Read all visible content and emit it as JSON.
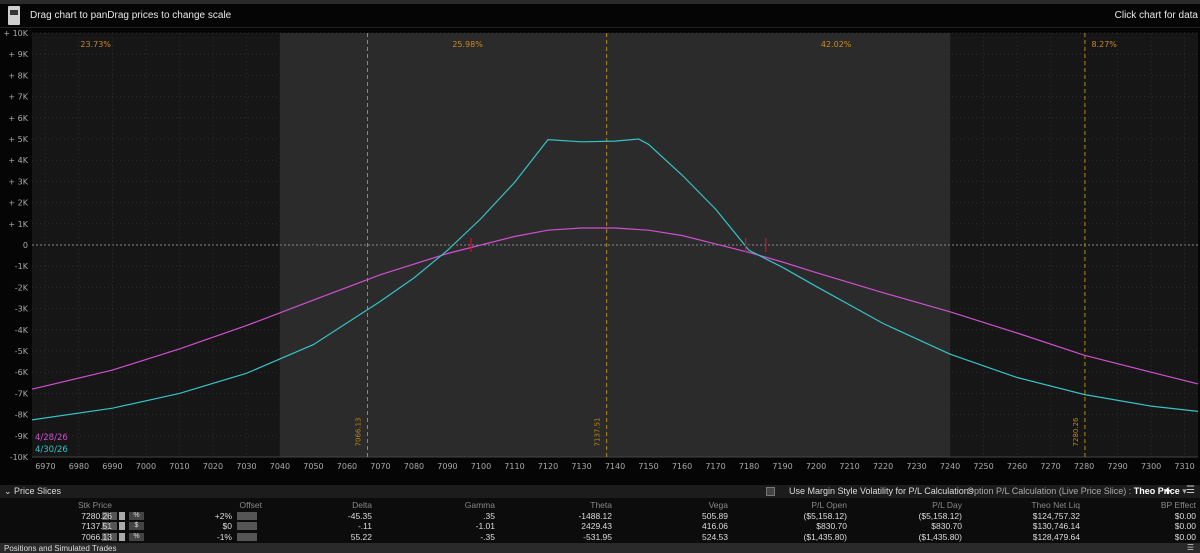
{
  "header": {
    "hint_left": "Drag chart to panDrag prices to change scale",
    "hint_right": "Click chart for data"
  },
  "chart_data": {
    "type": "line",
    "x_ticks": [
      6970,
      6980,
      6990,
      7000,
      7010,
      7020,
      7030,
      7040,
      7050,
      7060,
      7070,
      7080,
      7090,
      7100,
      7110,
      7120,
      7130,
      7140,
      7150,
      7160,
      7170,
      7180,
      7190,
      7200,
      7210,
      7220,
      7230,
      7240,
      7250,
      7260,
      7270,
      7280,
      7290,
      7300,
      7310
    ],
    "y_ticks": [
      10000,
      9000,
      8000,
      7000,
      6000,
      5000,
      4000,
      3000,
      2000,
      1000,
      0,
      -1000,
      -2000,
      -3000,
      -4000,
      -5000,
      -6000,
      -7000,
      -8000,
      -9000,
      -10000
    ],
    "y_tick_labels": [
      "+ 10K",
      "+ 9K",
      "+ 8K",
      "+ 7K",
      "+ 6K",
      "+ 5K",
      "+ 4K",
      "+ 3K",
      "+ 2K",
      "+ 1K",
      "0",
      "-1K",
      "-2K",
      "-3K",
      "-4K",
      "-5K",
      "-6K",
      "-7K",
      "-8K",
      "-9K",
      "-10K"
    ],
    "xlim": [
      6966,
      7314
    ],
    "ylim": [
      -10000,
      10000
    ],
    "zones": [
      {
        "from": 6966,
        "to": 7040,
        "label": "23.73%"
      },
      {
        "from": 7040,
        "to": 7240,
        "label": "25.98%"
      },
      {
        "from": 7140,
        "to": 7240,
        "label": "42.02%"
      },
      {
        "from": 7240,
        "to": 7314,
        "label": "8.27%"
      }
    ],
    "zone_label_x": [
      6985,
      7096,
      7206,
      7286
    ],
    "vlines": [
      {
        "x": 7066.13,
        "label": "7066.13"
      },
      {
        "x": 7137.51,
        "label": "7137.51"
      },
      {
        "x": 7280.26,
        "label": "7280.26"
      }
    ],
    "series": [
      {
        "name": "4/28/26",
        "color": "#d04fd0",
        "x": [
          6966,
          6990,
          7010,
          7030,
          7050,
          7070,
          7090,
          7100,
          7110,
          7120,
          7130,
          7140,
          7150,
          7160,
          7170,
          7180,
          7190,
          7200,
          7220,
          7240,
          7260,
          7280,
          7300,
          7314
        ],
        "y": [
          -6800,
          -5900,
          -4900,
          -3800,
          -2600,
          -1400,
          -400,
          0,
          400,
          700,
          800,
          800,
          700,
          450,
          50,
          -350,
          -800,
          -1300,
          -2250,
          -3150,
          -4150,
          -5200,
          -6000,
          -6550
        ]
      },
      {
        "name": "4/30/26",
        "color": "#35c3c8",
        "x": [
          6966,
          6990,
          7010,
          7030,
          7050,
          7070,
          7080,
          7090,
          7100,
          7110,
          7120,
          7130,
          7140,
          7147,
          7150,
          7160,
          7170,
          7180,
          7190,
          7200,
          7220,
          7240,
          7260,
          7280,
          7300,
          7314
        ],
        "y": [
          -8250,
          -7700,
          -7000,
          -6050,
          -4700,
          -2650,
          -1550,
          -250,
          1250,
          2950,
          4970,
          4870,
          4900,
          5000,
          4750,
          3300,
          1700,
          -250,
          -1050,
          -1950,
          -3700,
          -5150,
          -6250,
          -7050,
          -7600,
          -7850
        ]
      }
    ],
    "markers": [
      7097,
      7179,
      7185
    ]
  },
  "panel": {
    "section_label": "Price Slices",
    "margin_style_label": "Use Margin Style Volatility for P/L Calculations",
    "option_calc_label": "Option P/L Calculation (Live Price Slice) : ",
    "option_calc_value": "Theo Price",
    "columns": [
      "Stk Price",
      "Offset",
      "Delta",
      "Gamma",
      "Theta",
      "Vega",
      "P/L Open",
      "P/L Day",
      "Theo Net Liq",
      "BP Effect"
    ],
    "rows": [
      {
        "stk": "7280.26",
        "mode": "%",
        "offset": "+2%",
        "delta": "-45.35",
        "gamma": ".35",
        "theta": "-1488.12",
        "vega": "505.89",
        "pl_open": "($5,158.12)",
        "pl_day": "($5,158.12)",
        "theo": "$124,757.32",
        "bp": "$0.00"
      },
      {
        "stk": "7137.51",
        "mode": "$",
        "offset": "$0",
        "delta": "-.11",
        "gamma": "-1.01",
        "theta": "2429.43",
        "vega": "416.06",
        "pl_open": "$830.70",
        "pl_day": "$830.70",
        "theo": "$130,746.14",
        "bp": "$0.00"
      },
      {
        "stk": "7066.13",
        "mode": "%",
        "offset": "-1%",
        "delta": "55.22",
        "gamma": "-.35",
        "theta": "-531.95",
        "vega": "524.53",
        "pl_open": "($1,435.80)",
        "pl_day": "($1,435.80)",
        "theo": "$128,479.64",
        "bp": "$0.00"
      }
    ]
  },
  "bottom": {
    "label": "Positions and Simulated Trades"
  }
}
